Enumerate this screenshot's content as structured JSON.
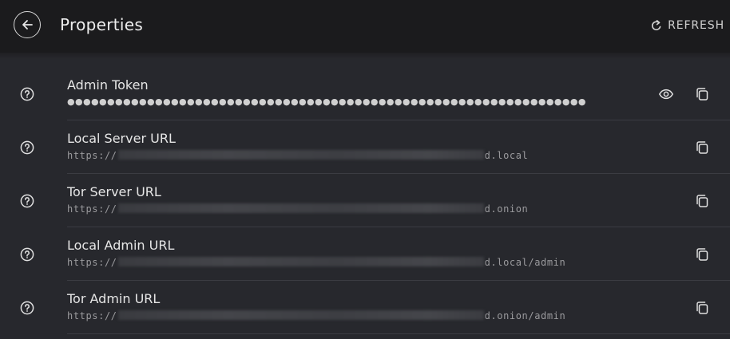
{
  "header": {
    "title": "Properties",
    "refresh_label": "REFRESH"
  },
  "properties": [
    {
      "label": "Admin Token",
      "value": "●●●●●●●●●●●●●●●●●●●●●●●●●●●●●●●●●●●●●●●●●●●●●●●●●●●●●●●●●●●●●●●●●",
      "masked": true
    },
    {
      "label": "Local Server URL",
      "prefix": "https://",
      "suffix": "d.local"
    },
    {
      "label": "Tor Server URL",
      "prefix": "https://",
      "suffix": "d.onion"
    },
    {
      "label": "Local Admin URL",
      "prefix": "https://",
      "suffix": "d.local/admin"
    },
    {
      "label": "Tor Admin URL",
      "prefix": "https://",
      "suffix": "d.onion/admin"
    }
  ],
  "icons": {
    "back": "arrow-left-icon",
    "refresh": "refresh-icon",
    "help": "help-circle-icon",
    "reveal": "eye-icon",
    "copy": "copy-icon"
  },
  "colors": {
    "background": "#27282d",
    "header": "#1b1b1d",
    "text": "#e6e6e6",
    "muted": "#9a9a9d"
  }
}
